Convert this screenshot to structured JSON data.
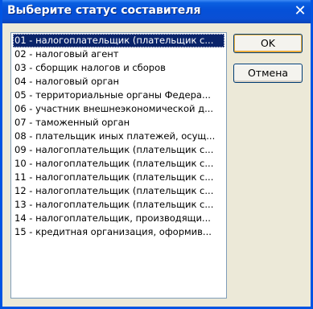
{
  "dialog": {
    "title": "Выберите статус составителя",
    "close_glyph": "✕"
  },
  "list": {
    "selected_index": 0,
    "items": [
      "01 - налогоплательщик (плательщик с...",
      "02 - налоговый агент",
      "03 - сборщик налогов и сборов",
      "04 - налоговый орган",
      "05 - территориальные органы Федера...",
      "06 - участник внешнеэкономической д...",
      "07 - таможенный орган",
      "08 - плательщик иных платежей, осущ...",
      "09 - налогоплательщик (плательщик с...",
      "10 - налогоплательщик (плательщик с...",
      "11 - налогоплательщик (плательщик с...",
      "12 - налогоплательщик (плательщик с...",
      "13 - налогоплательщик (плательщик с...",
      "14 - налогоплательщик, производящи...",
      "15 - кредитная организация, оформив..."
    ]
  },
  "buttons": {
    "ok_label": "OK",
    "cancel_label": "Отмена"
  },
  "colors": {
    "selection": "#0a246a",
    "titlebar": "#0551d8",
    "window_bg": "#ece9d8"
  }
}
